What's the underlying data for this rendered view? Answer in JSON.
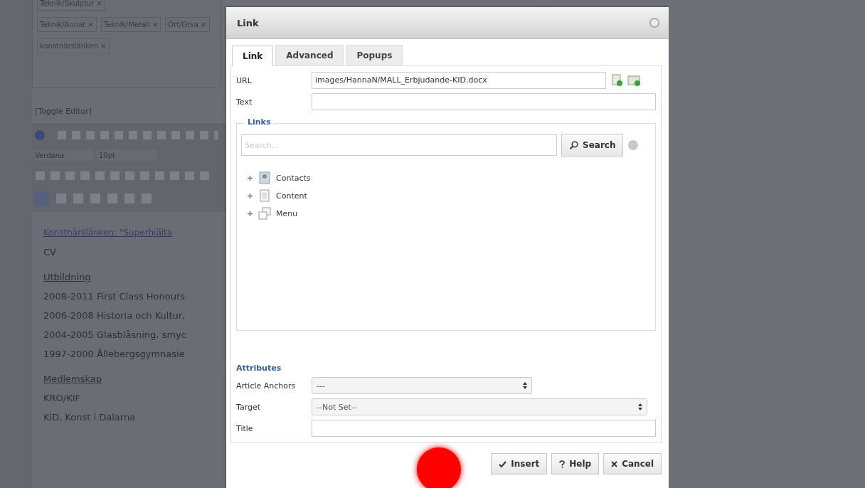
{
  "background_page": {
    "tags": [
      {
        "label": "Teknik/Skulptur ×"
      },
      {
        "label": "Teknik/Annat ×"
      },
      {
        "label": "Teknik/Metall ×"
      },
      {
        "label": "Ort/Orsa ×"
      },
      {
        "label": "konstnärslänken ×"
      }
    ],
    "toggle_editor": "[Toggle Editor]",
    "toolbar": {
      "font": "Verdana",
      "size": "10pt"
    },
    "content": [
      {
        "kind": "link",
        "text": "Konstnärslänken: \"Superhjälta"
      },
      {
        "kind": "text",
        "text": "CV"
      },
      {
        "kind": "heading",
        "text": "Utbildning"
      },
      {
        "kind": "text",
        "text": "2008-2011 First Class Honours"
      },
      {
        "kind": "text",
        "text": "2006-2008 Historia och Kultur,"
      },
      {
        "kind": "text",
        "text": "2004-2005 Glasblåsning, smyc"
      },
      {
        "kind": "text",
        "text": "1997-2000 Ållebergsgymnasie"
      },
      {
        "kind": "heading",
        "text": "Medlemskap"
      },
      {
        "kind": "text",
        "text": "KRO/KIF"
      },
      {
        "kind": "text",
        "text": "KiD, Konst i Dalarna"
      }
    ]
  },
  "dialog": {
    "title": "Link",
    "tabs": [
      {
        "label": "Link",
        "selected": true
      },
      {
        "label": "Advanced",
        "selected": false
      },
      {
        "label": "Popups",
        "selected": false
      }
    ],
    "url": {
      "label": "URL",
      "value": "images/HannaN/MALL_Erbjudande-KID.docx"
    },
    "text": {
      "label": "Text"
    },
    "links": {
      "legend": "Links",
      "search": {
        "placeholder": "Search...",
        "button": "Search"
      },
      "tree": [
        {
          "kind": "contacts",
          "label": "Contacts",
          "expanded": false
        },
        {
          "kind": "content",
          "label": "Content",
          "expanded": false
        },
        {
          "kind": "menu",
          "label": "Menu",
          "expanded": false
        }
      ]
    },
    "attributes": {
      "legend": "Attributes",
      "anchors": {
        "label": "Article Anchors",
        "value": "---"
      },
      "target": {
        "label": "Target",
        "value": "--Not Set--"
      },
      "title": {
        "label": "Title"
      }
    },
    "buttons": [
      {
        "kind": "insert",
        "label": "Insert"
      },
      {
        "kind": "help",
        "label": "Help"
      },
      {
        "kind": "cancel",
        "label": "Cancel"
      }
    ]
  }
}
